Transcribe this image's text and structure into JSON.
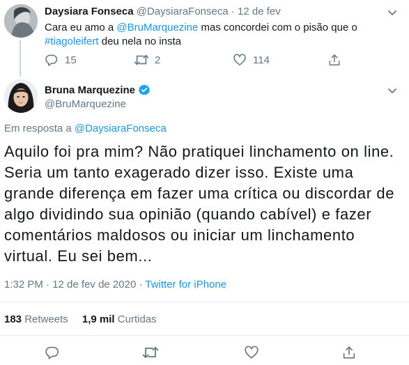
{
  "parent": {
    "name": "Daysiara Fonseca",
    "handle": "@DaysiaraFonseca",
    "sep": "·",
    "date": "12 de fev",
    "text_before": "Cara eu amo a ",
    "mention": "@BruMarquezine",
    "text_mid": " mas concordei com o pisão que o",
    "hashtag": "#tiagoleifert",
    "text_after": " deu nela no insta",
    "reply_count": "15",
    "retweet_count": "2",
    "like_count": "114"
  },
  "main": {
    "name": "Bruna Marquezine",
    "handle": "@BruMarquezine",
    "reply_prefix": "Em resposta a ",
    "reply_to": "@DaysiaraFonseca",
    "text": "Aquilo foi pra mim? Não pratiquei linchamento on line. Seria um tanto exagerado dizer isso. Existe uma grande diferença em fazer uma crítica ou discordar de algo dividindo sua opinião (quando cabível) e fazer comentários maldosos ou iniciar um linchamento virtual. Eu sei bem...",
    "time": "1:32 PM · 12 de fev de 2020",
    "meta_sep": " · ",
    "source": "Twitter for iPhone",
    "retweets_count": "183",
    "retweets_label": "Retweets",
    "likes_count": "1,9 mil",
    "likes_label": "Curtidas"
  },
  "colors": {
    "link": "#1b95e0",
    "secondary": "#657786",
    "divider": "#e6ecf0",
    "verified": "#1da1f2"
  },
  "icons": [
    "reply-icon",
    "retweet-icon",
    "like-icon",
    "share-icon",
    "chevron-down-icon",
    "verified-badge-icon"
  ]
}
